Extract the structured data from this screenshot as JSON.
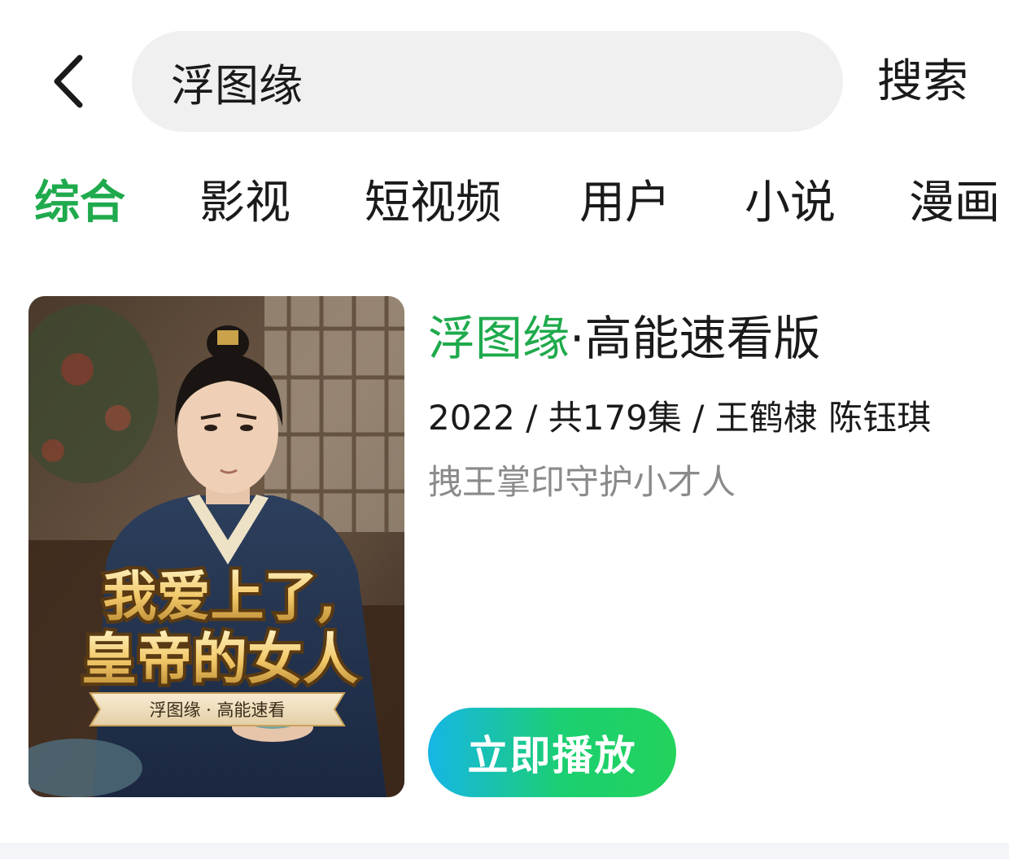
{
  "search": {
    "value": "浮图缘",
    "button_label": "搜索"
  },
  "tabs": [
    {
      "label": "综合",
      "active": true
    },
    {
      "label": "影视",
      "active": false
    },
    {
      "label": "短视频",
      "active": false
    },
    {
      "label": "用户",
      "active": false
    },
    {
      "label": "小说",
      "active": false
    },
    {
      "label": "漫画",
      "active": false
    }
  ],
  "result": {
    "title_highlight": "浮图缘",
    "title_rest": "·高能速看版",
    "meta": "2022 / 共179集 / 王鹤棣 陈钰琪",
    "description": "拽王掌印守护小才人",
    "play_label": "立即播放",
    "poster": {
      "headline_line1": "我爱上了,",
      "headline_line2": "皇帝的女人",
      "ribbon_text": "浮图缘 · 高能速看"
    }
  },
  "colors": {
    "accent": "#1faa4d",
    "search_bg": "#f0f0f0",
    "secondary_text": "#8a8a8a"
  }
}
